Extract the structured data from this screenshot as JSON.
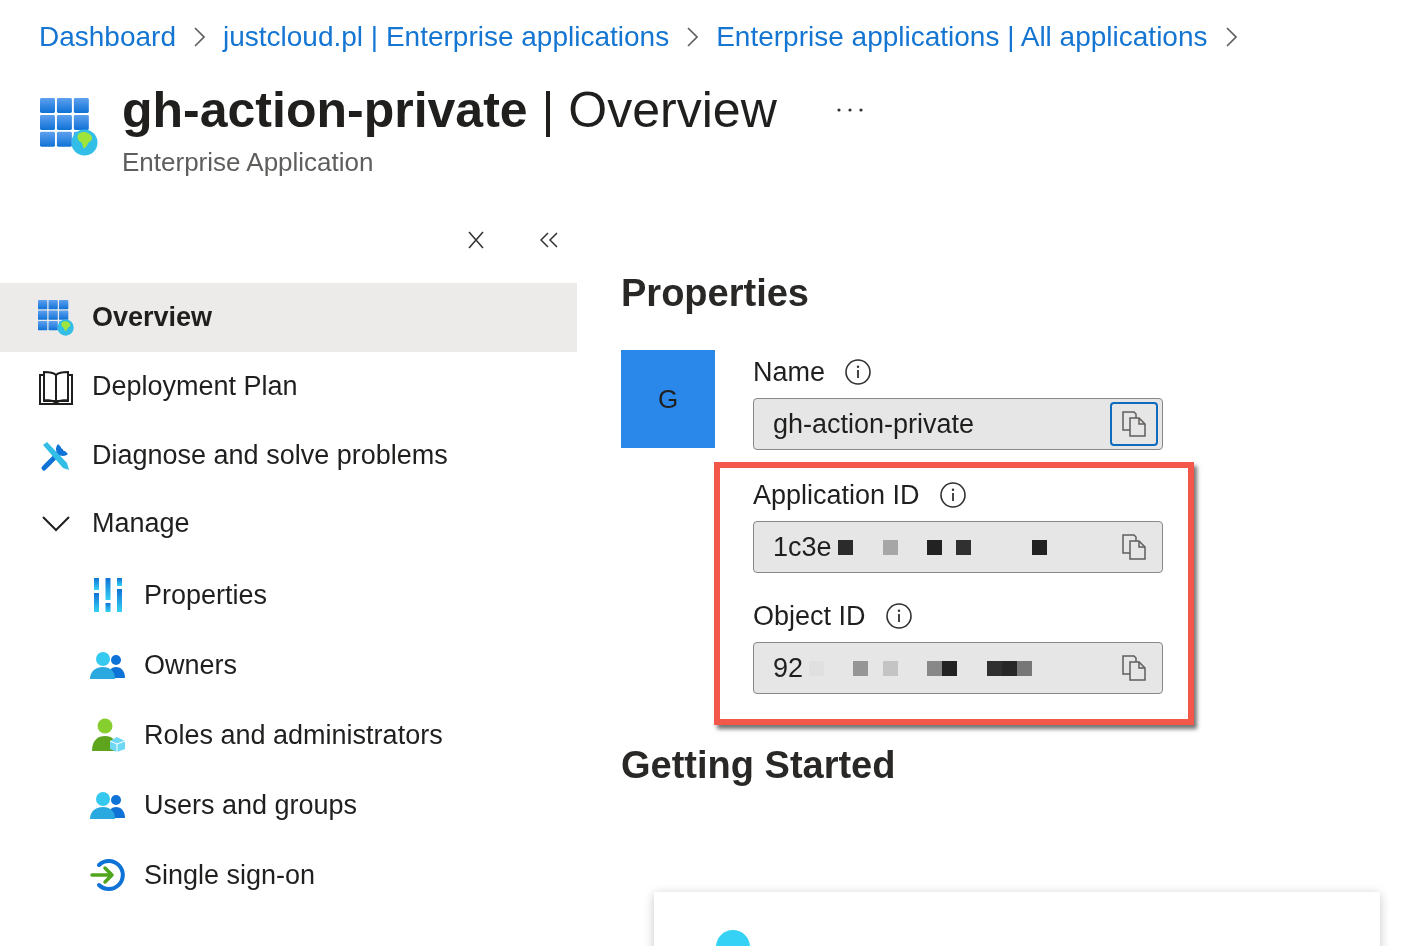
{
  "breadcrumb": [
    {
      "label": "Dashboard"
    },
    {
      "label": "justcloud.pl | Enterprise applications"
    },
    {
      "label": "Enterprise applications | All applications"
    }
  ],
  "header": {
    "title": "**gh-action-private** | Overview",
    "subtitle": "Enterprise Application"
  },
  "sidebar": {
    "items": [
      {
        "kind": "link",
        "label": "Overview",
        "selected": true
      },
      {
        "kind": "link",
        "label": "Deployment Plan",
        "selected": false
      },
      {
        "kind": "link",
        "label": "Diagnose and solve problems",
        "selected": false
      },
      {
        "kind": "group",
        "label": "Manage",
        "expanded": true,
        "children": [
          {
            "label": "Properties",
            "selected": false
          },
          {
            "label": "Owners",
            "selected": false
          },
          {
            "label": "Roles and administrators",
            "selected": false
          },
          {
            "label": "Users and groups",
            "selected": false
          },
          {
            "label": "Single sign-on",
            "selected": false
          }
        ]
      }
    ]
  },
  "properties": {
    "heading": "Properties",
    "tile": "G",
    "fields": [
      {
        "label": "Name",
        "value": "gh-action-private",
        "redacted": false,
        "highlighted": false,
        "copy_focused": true
      },
      {
        "label": "Application ID",
        "value": "1c3e",
        "redacted": true,
        "highlighted": true,
        "copy_focused": false
      },
      {
        "label": "Object ID",
        "value": "92",
        "redacted": true,
        "highlighted": true,
        "copy_focused": false
      }
    ]
  },
  "getting_started": {
    "heading": "Getting Started"
  }
}
